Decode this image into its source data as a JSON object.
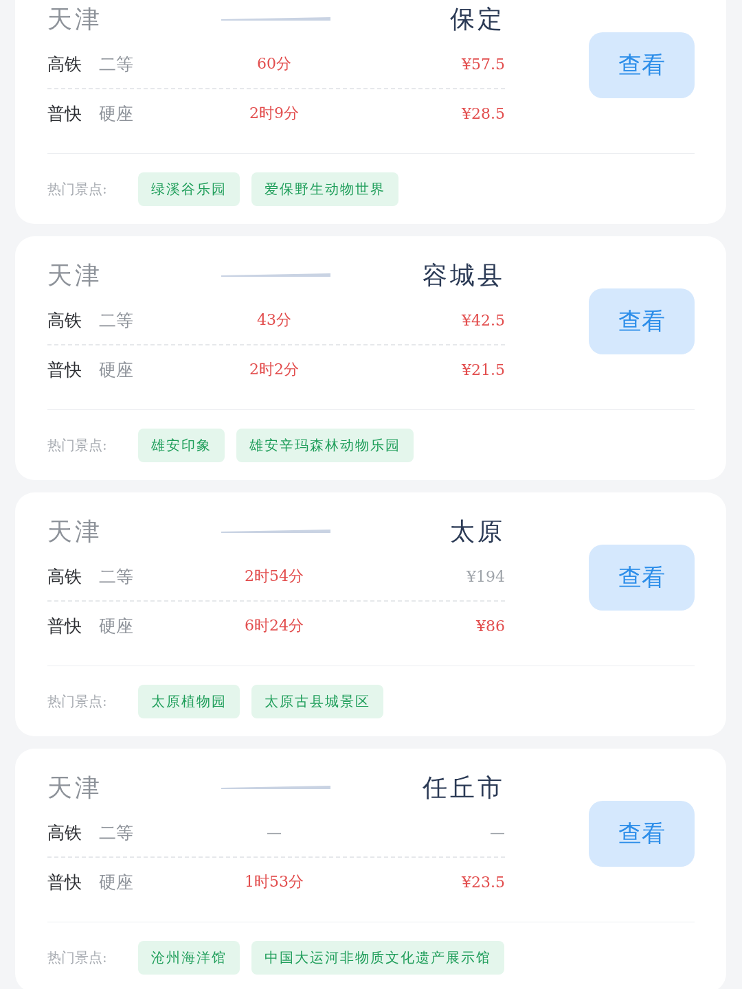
{
  "routes": [
    {
      "from": "天津",
      "to": "保定",
      "trains": [
        {
          "type": "高铁",
          "seat": "二等",
          "duration": "60分",
          "duration_highlight": true,
          "price": "¥57.5",
          "price_highlight": true
        },
        {
          "type": "普快",
          "seat": "硬座",
          "duration": "2时9分",
          "duration_highlight": true,
          "price": "¥28.5",
          "price_highlight": true
        }
      ],
      "button": "查看",
      "spots_label": "热门景点:",
      "spots": [
        "绿溪谷乐园",
        "爱保野生动物世界"
      ]
    },
    {
      "from": "天津",
      "to": "容城县",
      "trains": [
        {
          "type": "高铁",
          "seat": "二等",
          "duration": "43分",
          "duration_highlight": true,
          "price": "¥42.5",
          "price_highlight": true
        },
        {
          "type": "普快",
          "seat": "硬座",
          "duration": "2时2分",
          "duration_highlight": true,
          "price": "¥21.5",
          "price_highlight": true
        }
      ],
      "button": "查看",
      "spots_label": "热门景点:",
      "spots": [
        "雄安印象",
        "雄安辛玛森林动物乐园"
      ]
    },
    {
      "from": "天津",
      "to": "太原",
      "trains": [
        {
          "type": "高铁",
          "seat": "二等",
          "duration": "2时54分",
          "duration_highlight": true,
          "price": "¥194",
          "price_highlight": false
        },
        {
          "type": "普快",
          "seat": "硬座",
          "duration": "6时24分",
          "duration_highlight": true,
          "price": "¥86",
          "price_highlight": true
        }
      ],
      "button": "查看",
      "spots_label": "热门景点:",
      "spots": [
        "太原植物园",
        "太原古县城景区"
      ]
    },
    {
      "from": "天津",
      "to": "任丘市",
      "trains": [
        {
          "type": "高铁",
          "seat": "二等",
          "duration": "—",
          "duration_highlight": false,
          "price": "—",
          "price_highlight": false
        },
        {
          "type": "普快",
          "seat": "硬座",
          "duration": "1时53分",
          "duration_highlight": true,
          "price": "¥23.5",
          "price_highlight": true
        }
      ],
      "button": "查看",
      "spots_label": "热门景点:",
      "spots": [
        "沧州海洋馆",
        "中国大运河非物质文化遗产展示馆"
      ]
    }
  ]
}
